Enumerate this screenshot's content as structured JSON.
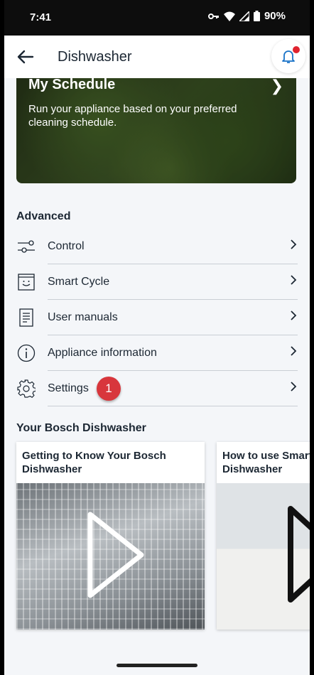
{
  "status_bar": {
    "time": "7:41",
    "battery": "90%"
  },
  "app_bar": {
    "title": "Dishwasher"
  },
  "schedule_card": {
    "title": "My Schedule",
    "description": "Run your appliance based on your preferred cleaning schedule."
  },
  "advanced": {
    "heading": "Advanced",
    "items": [
      {
        "label": "Control",
        "icon": "sliders-icon"
      },
      {
        "label": "Smart Cycle",
        "icon": "smart-cycle-icon"
      },
      {
        "label": "User manuals",
        "icon": "document-icon"
      },
      {
        "label": "Appliance information",
        "icon": "info-icon"
      },
      {
        "label": "Settings",
        "icon": "gear-icon"
      }
    ],
    "settings_badge": "1"
  },
  "your_dishwasher": {
    "heading": "Your Bosch Dishwasher",
    "videos": [
      {
        "title": "Getting to Know Your Bosch Dishwasher"
      },
      {
        "title": "How to use Smart Cycle in Your Dishwasher"
      }
    ]
  },
  "colors": {
    "accent_badge": "#d8363c",
    "notification_dot": "#e0232f",
    "bell_blue": "#1a73c8"
  }
}
